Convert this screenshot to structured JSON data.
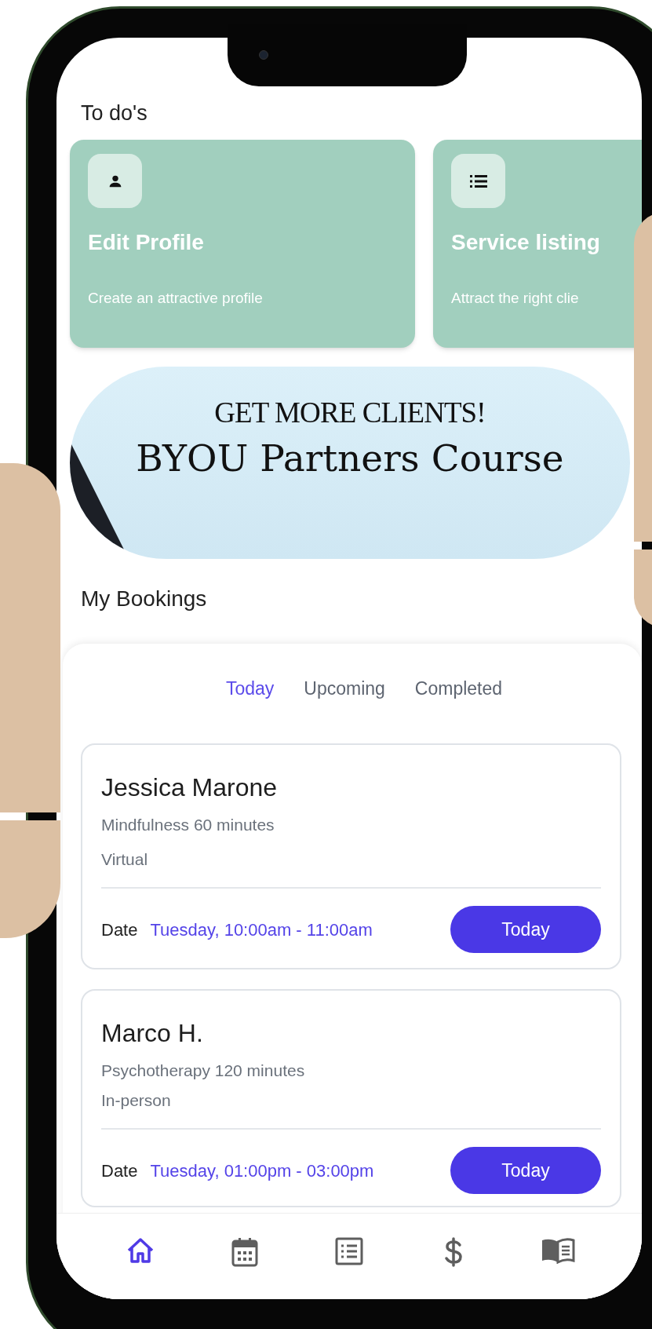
{
  "section_title": "To do's",
  "todos": [
    {
      "kind": "profile",
      "title": "Edit Profile",
      "subtitle": "Create an attractive profile"
    },
    {
      "kind": "list",
      "title": "Service listing",
      "subtitle": "Attract the right clie"
    }
  ],
  "banner": {
    "headline": "GET MORE CLIENTS!",
    "title": "BYOU Partners Course"
  },
  "bookings_title": "My Bookings",
  "tabs": [
    {
      "label": "Today",
      "selected": true
    },
    {
      "label": "Upcoming",
      "selected": false
    },
    {
      "label": "Completed",
      "selected": false
    }
  ],
  "bookings": [
    {
      "name": "Jessica Marone",
      "service": "Mindfulness 60 minutes",
      "mode": "Virtual",
      "date_label": "Date",
      "time": "Tuesday, 10:00am - 11:00am",
      "action": "Today"
    },
    {
      "name": "Marco H.",
      "service": "Psychotherapy 120 minutes",
      "mode": "In-person",
      "date_label": "Date",
      "time": "Tuesday, 01:00pm - 03:00pm",
      "action": "Today"
    }
  ],
  "nav": [
    {
      "kind": "home",
      "selected": true
    },
    {
      "kind": "calendar",
      "selected": false
    },
    {
      "kind": "list",
      "selected": false
    },
    {
      "kind": "dollar",
      "selected": false
    },
    {
      "kind": "book",
      "selected": false
    }
  ]
}
